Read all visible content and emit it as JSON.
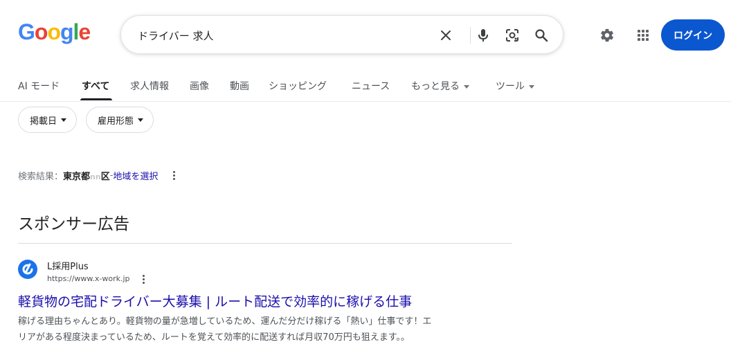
{
  "logo": {
    "letters": [
      "G",
      "o",
      "o",
      "g",
      "l",
      "e"
    ]
  },
  "search": {
    "value": "ドライバー 求人",
    "placeholder": ""
  },
  "header": {
    "login_label": "ログイン"
  },
  "tabs": [
    {
      "label": "AI モード"
    },
    {
      "label": "すべて",
      "active": true
    },
    {
      "label": "求人情報"
    },
    {
      "label": "画像"
    },
    {
      "label": "動画"
    },
    {
      "label": "ショッピング"
    },
    {
      "label": "ニュース"
    },
    {
      "label": "もっと見る"
    },
    {
      "label": "ツール"
    }
  ],
  "filters": [
    {
      "label": "掲載日"
    },
    {
      "label": "雇用形態"
    }
  ],
  "location": {
    "prefix": "検索結果：",
    "place": "東京都",
    "redacted": "nn",
    "ward": "区",
    "separator": " - ",
    "link": "地域を選択"
  },
  "sponsor": {
    "heading": "スポンサー広告"
  },
  "ad": {
    "site_name": "L採用Plus",
    "url": "https://www.x-work.jp",
    "title": "軽貨物の宅配ドライバー大募集 | ルート配送で効率的に稼げる仕事",
    "description_line1": "稼げる理由ちゃんとあり。軽貨物の量が急増しているため、運んだ分だけ稼げる「熱い」仕事です！エ",
    "description_line2": "リアがある程度決まっているため、ルートを覚えて効率的に配送すれば月収70万円も狙えます。。"
  },
  "icons": {
    "clear": "close-icon",
    "voice": "microphone-icon",
    "lens": "camera-lens-icon",
    "search": "search-icon",
    "settings": "gear-icon",
    "apps": "apps-grid-icon"
  },
  "colors": {
    "link": "#1a0dab",
    "login_button": "#0b57d0"
  }
}
